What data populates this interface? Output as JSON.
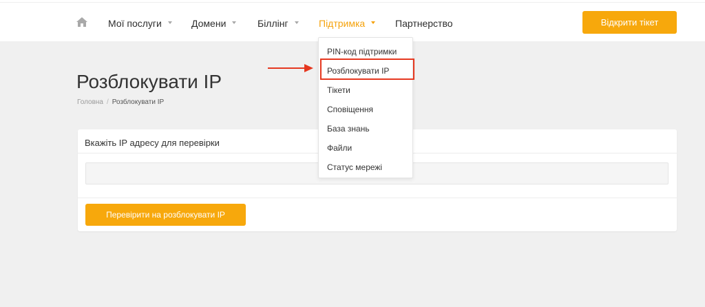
{
  "nav": {
    "home_icon": "home-icon",
    "items": [
      {
        "label": "Мої послуги"
      },
      {
        "label": "Домени"
      },
      {
        "label": "Біллінг"
      },
      {
        "label": "Підтримка"
      },
      {
        "label": "Партнерство"
      }
    ],
    "active_item": "Підтримка",
    "ticket_button": "Відкрити тікет"
  },
  "dropdown": {
    "items": [
      {
        "label": "PIN-код підтримки"
      },
      {
        "label": "Розблокувати IP"
      },
      {
        "label": "Тікети"
      },
      {
        "label": "Сповіщення"
      },
      {
        "label": "База знань"
      },
      {
        "label": "Файли"
      },
      {
        "label": "Статус мережі"
      }
    ],
    "highlighted_item": "Розблокувати IP"
  },
  "page": {
    "title": "Розблокувати IP",
    "breadcrumb": {
      "home": "Головна",
      "separator": "/",
      "current": "Розблокувати IP"
    }
  },
  "panel": {
    "heading": "Вкажіть IP адресу для перевірки",
    "ip_input_value": "",
    "ip_input_placeholder": "",
    "submit_label": "Перевірити на розблокувати IP"
  },
  "colors": {
    "accent": "#f7a80c",
    "highlight": "#e5371f",
    "background": "#f0f0f0"
  }
}
